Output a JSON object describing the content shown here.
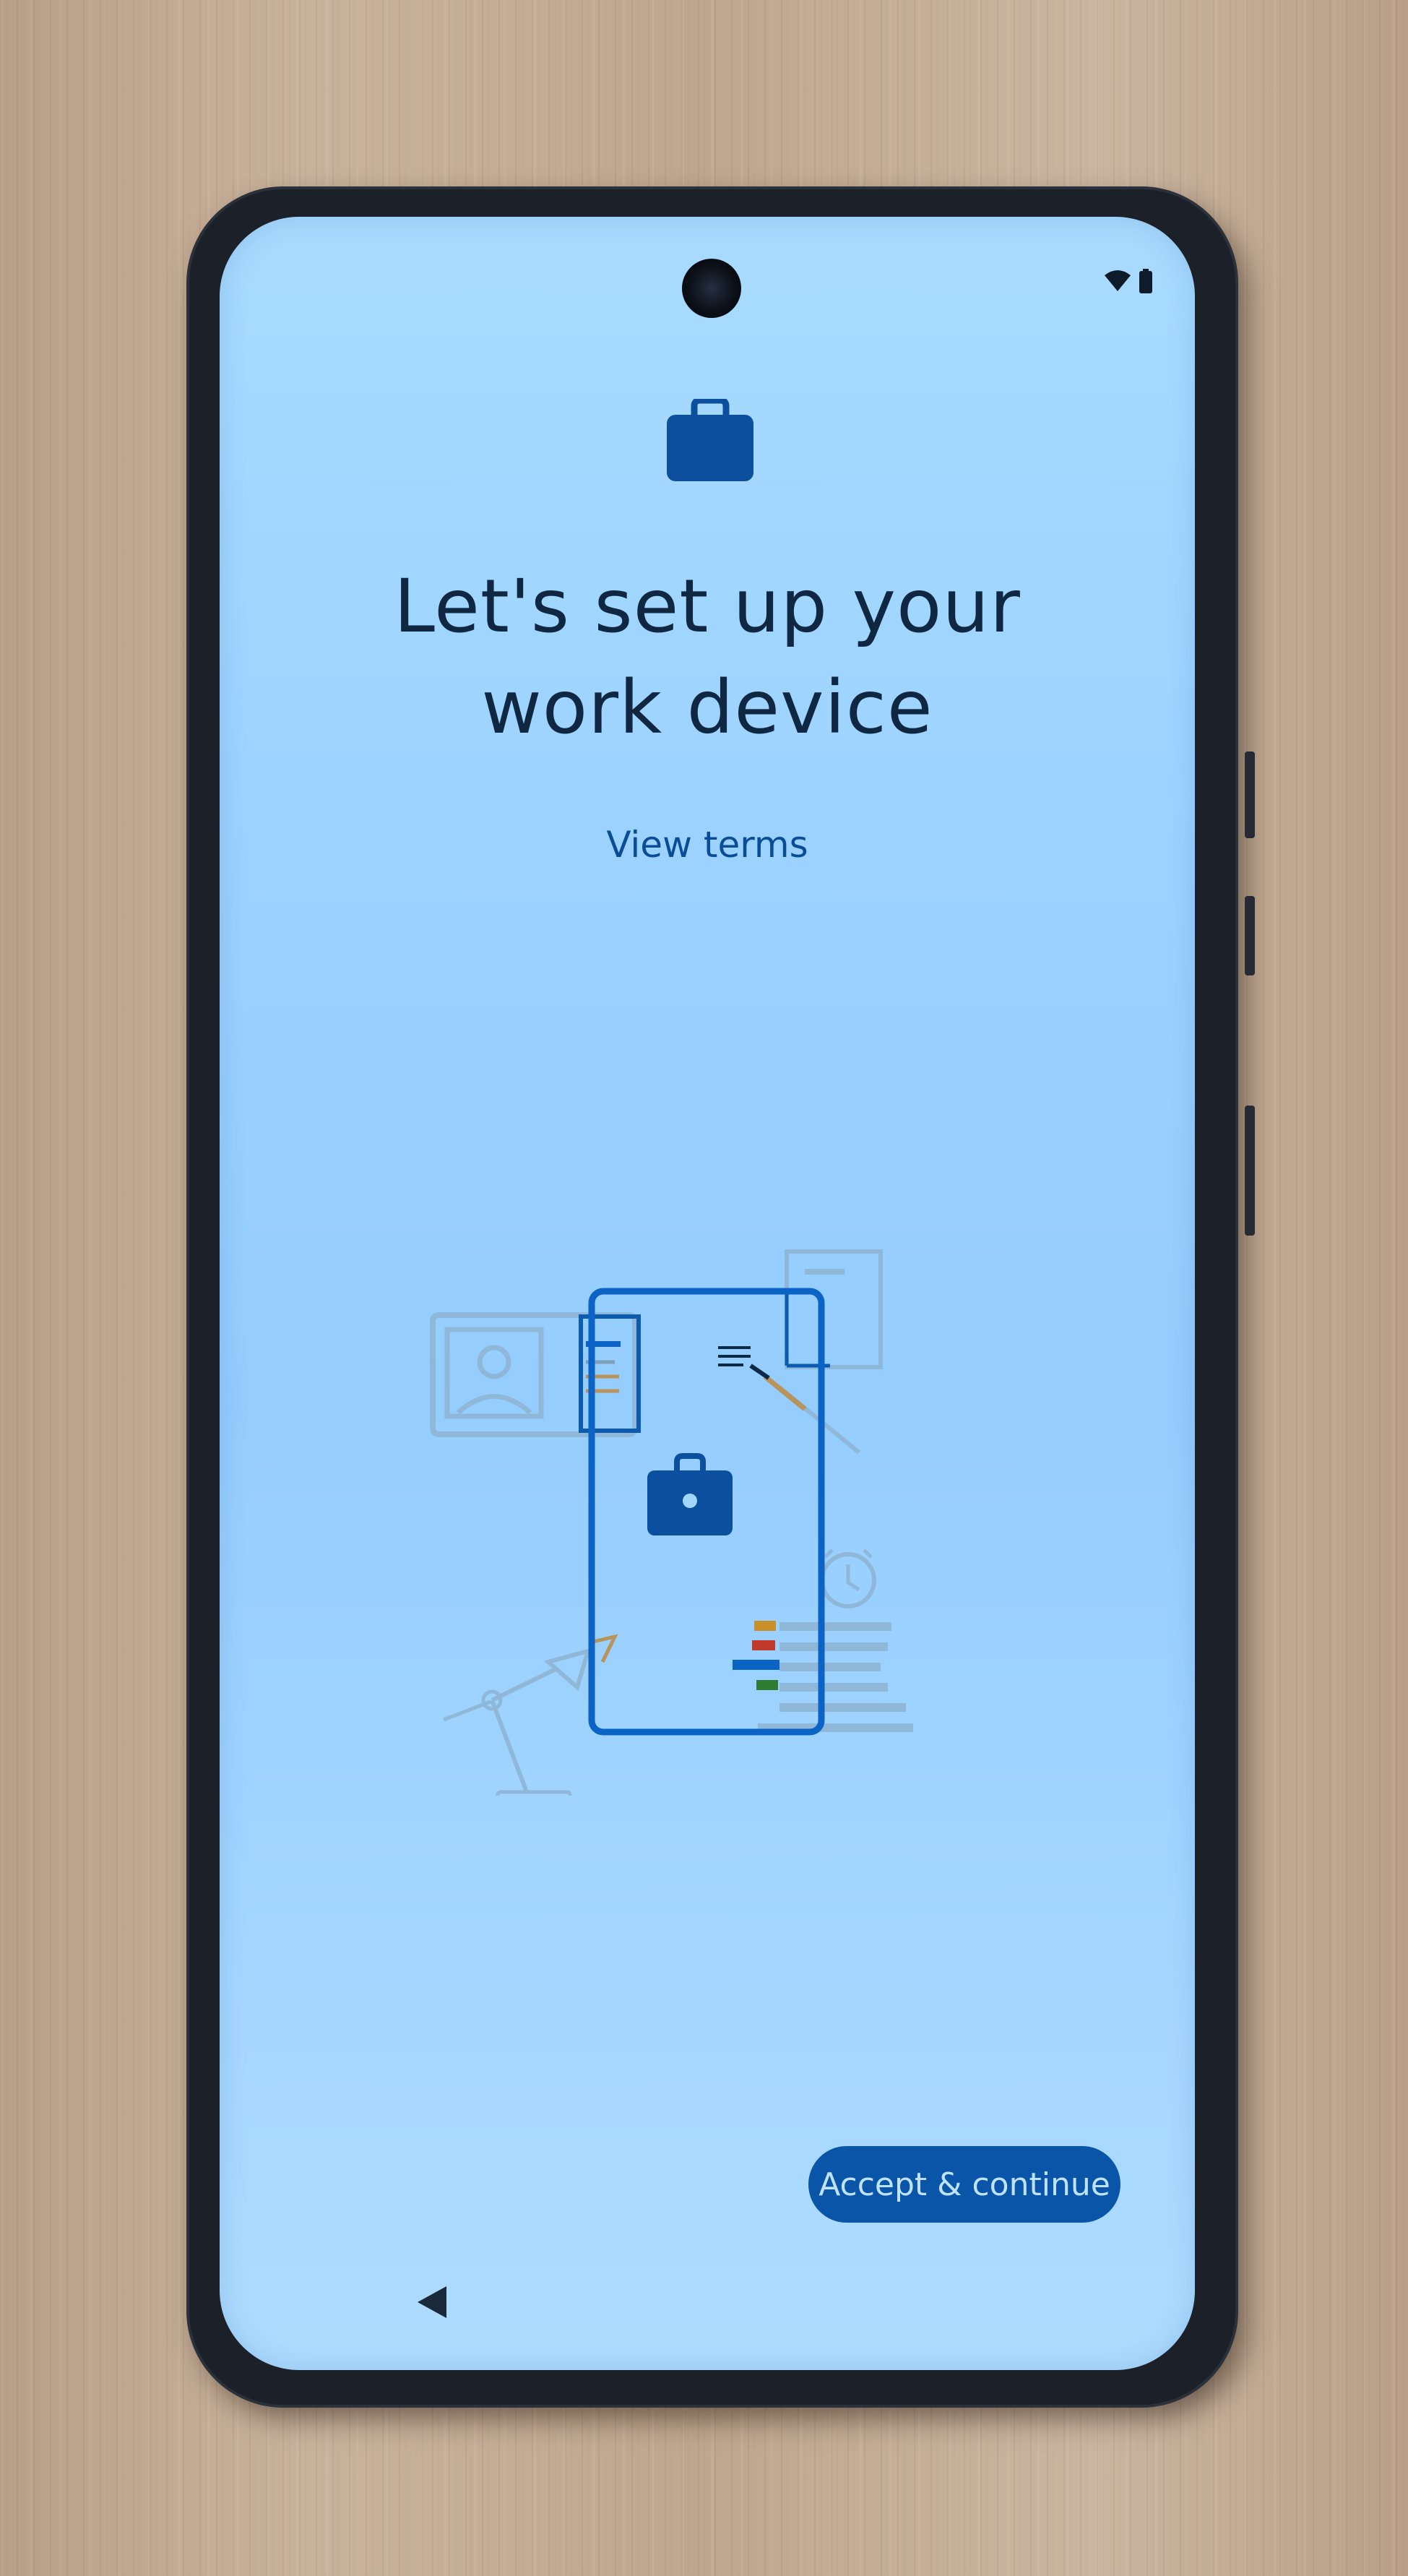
{
  "status_bar": {
    "wifi_icon": "wifi-icon",
    "battery_icon": "battery-icon"
  },
  "header": {
    "icon": "briefcase-icon",
    "title": "Let's set up your\nwork device"
  },
  "links": {
    "view_terms": "View terms"
  },
  "illustration": {
    "name": "work-device-setup-illustration"
  },
  "actions": {
    "accept_label": "Accept & continue"
  },
  "navigation": {
    "back_icon": "back-triangle-icon"
  },
  "colors": {
    "screen_background": "#9bd2ff",
    "title_text": "#0f2740",
    "link_text": "#0a4d96",
    "primary_button": "#0a55a8",
    "primary_button_text": "#bfe3ff",
    "accent_blue": "#0b63c6"
  }
}
